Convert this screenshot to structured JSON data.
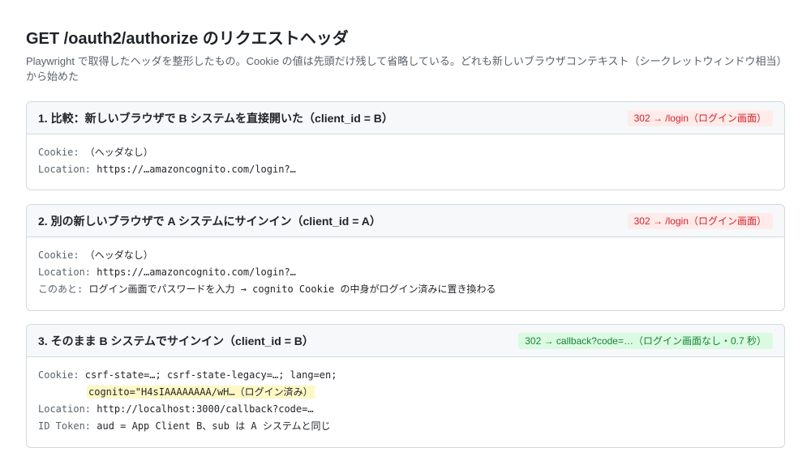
{
  "header": {
    "title": "GET /oauth2/authorize のリクエストヘッダ",
    "description_line1": "Playwright で取得したヘッダを整形したもの。Cookie の値は先頭だけ残して省略している。どれも新しいブラウザコンテキスト（シークレットウィンドウ相当）",
    "description_line2": "から始めた"
  },
  "cards": [
    {
      "title": "1. 比較：新しいブラウザで B システムを直接開いた（client_id = B）",
      "badge": "302 → /login（ログイン画面）",
      "badge_color": "#cf222e",
      "rows": [
        {
          "key": "Cookie:",
          "value": " （ヘッダなし）"
        },
        {
          "key": "Location:",
          "value": " https://…amazoncognito.com/login?…"
        }
      ]
    },
    {
      "title": "2. 別の新しいブラウザで A システムにサインイン（client_id = A）",
      "badge": "302 → /login（ログイン画面）",
      "badge_color": "#cf222e",
      "rows": [
        {
          "key": "Cookie:",
          "value": " （ヘッダなし）"
        },
        {
          "key": "Location:",
          "value": " https://…amazoncognito.com/login?…"
        },
        {
          "key": "このあと:",
          "value": " ログイン画面でパスワードを入力 → cognito Cookie の中身がログイン済みに置き換わる"
        }
      ]
    },
    {
      "title": "3. そのまま B システムでサインイン（client_id = B）",
      "badge": "302 → callback?code=…（ログイン画面なし・0.7 秒）",
      "badge_color": "#1a7f37",
      "rows": [
        {
          "key": "Cookie:",
          "value": " csrf-state=…; csrf-state-legacy=…; lang=en;"
        },
        {
          "key": "",
          "value": "cognito=\"H4sIAAAAAAAA/wH…（ログイン済み）"
        },
        {
          "key": "Location:",
          "value": " http://localhost:3000/callback?code=…"
        },
        {
          "key": "ID Token:",
          "value": " aud = App Client B、sub は A システムと同じ"
        }
      ]
    }
  ]
}
